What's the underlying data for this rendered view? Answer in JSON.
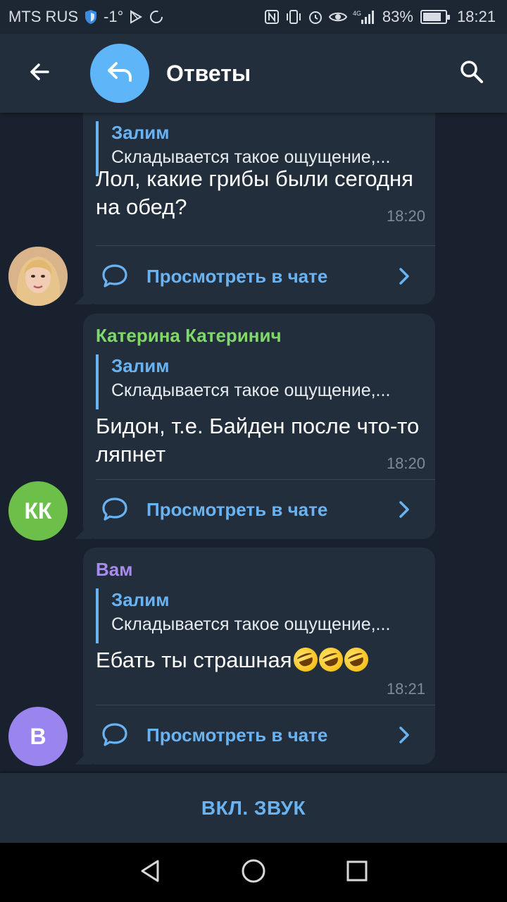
{
  "status_bar": {
    "carrier": "MTS RUS",
    "temperature": "-1°",
    "signal_label": "4G",
    "battery_percent": "83%",
    "battery_level": 0.83,
    "time": "18:21"
  },
  "header": {
    "title": "Ответы",
    "back_icon": "arrow-left-icon",
    "avatar_icon": "reply-arrow-icon",
    "search_icon": "search-icon",
    "avatar_color": "#5eb5f7"
  },
  "messages": [
    {
      "sender": "",
      "avatar_type": "photo",
      "reply_name": "Залим",
      "reply_text": "Складывается такое ощущение,...",
      "text": "Лол, какие грибы были сегодня на обед?",
      "time": "18:20",
      "view_label": "Просмотреть в чате"
    },
    {
      "sender": "Катерина Катеринич",
      "sender_color": "#7ed86a",
      "avatar_initials": "КК",
      "avatar_color": "#6cc04a",
      "reply_name": "Залим",
      "reply_text": "Складывается такое ощущение,...",
      "text": "Бидон, т.е. Байден после что-то ляпнет",
      "time": "18:20",
      "view_label": "Просмотреть в чате"
    },
    {
      "sender": "Вам",
      "sender_color": "#a98bf0",
      "avatar_initials": "В",
      "avatar_color": "#9a85ee",
      "reply_name": "Залим",
      "reply_text": "Складывается такое ощущение,...",
      "text": "Ебать ты страшная",
      "emoji_count": 3,
      "emoji": "rolling-on-floor-laughing",
      "time": "18:21",
      "view_label": "Просмотреть в чате"
    }
  ],
  "bottom_bar": {
    "label": "ВКЛ. ЗВУК"
  },
  "colors": {
    "background": "#18212d",
    "header": "#232e3c",
    "bubble": "#222e3b",
    "accent": "#6ab3f3",
    "time": "#7d8b99"
  }
}
